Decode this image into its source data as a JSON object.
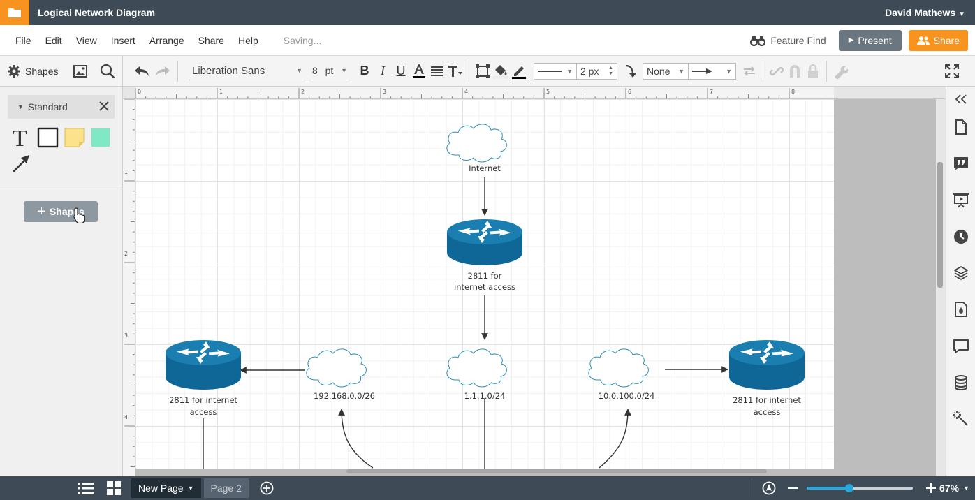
{
  "app": {
    "doc_title": "Logical Network Diagram",
    "user_name": "David Mathews",
    "brand_color": "#f7931e",
    "titlebar_color": "#3e4a56"
  },
  "menu": {
    "items": [
      "File",
      "Edit",
      "View",
      "Insert",
      "Arrange",
      "Share",
      "Help"
    ],
    "status": "Saving...",
    "feature_find": "Feature Find",
    "present": "Present",
    "share": "Share"
  },
  "toolbar": {
    "shapes_label": "Shapes",
    "font_family": "Liberation Sans",
    "font_size": "8",
    "font_unit": "pt",
    "line_width": "2 px",
    "arrow_start": "None"
  },
  "left_panel": {
    "library_name": "Standard",
    "add_shapes": "Shapes"
  },
  "ruler": {
    "top_ticks": [
      "0",
      "1",
      "2",
      "3",
      "4",
      "5",
      "6",
      "7",
      "8"
    ],
    "left_ticks": [
      "1",
      "2",
      "3",
      "4"
    ]
  },
  "diagram": {
    "internet": "Internet",
    "router_top_line1": "2811 for",
    "router_top_line2": "internet access",
    "cloud_left": "192.168.0.0/26",
    "cloud_center": "1.1.1.0/24",
    "cloud_right": "10.0.100.0/24",
    "router_left_line1": "2811 for internet",
    "router_left_line2": "access",
    "router_right_line1": "2811 for internet",
    "router_right_line2": "access",
    "router_color": "#0e6796"
  },
  "bottom": {
    "active_page": "New Page",
    "other_page": "Page 2",
    "zoom": "67%",
    "zoom_level": 0.4
  }
}
